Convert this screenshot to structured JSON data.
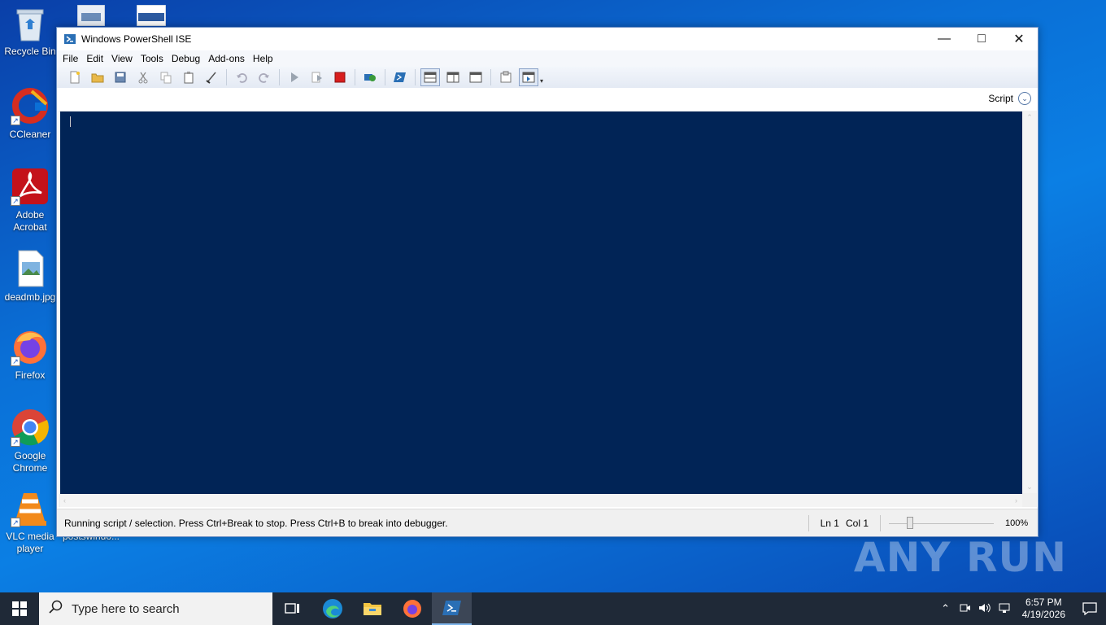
{
  "desktop": {
    "icons": [
      {
        "label": "Recycle Bin",
        "icon": "recycle-bin-icon"
      },
      {
        "label": "CCleaner",
        "icon": "ccleaner-icon"
      },
      {
        "label": "Adobe Acrobat",
        "icon": "acrobat-icon"
      },
      {
        "label": "deadmb.jpg",
        "icon": "image-file-icon"
      },
      {
        "label": "Firefox",
        "icon": "firefox-icon"
      },
      {
        "label": "Google Chrome",
        "icon": "chrome-icon"
      },
      {
        "label": "VLC media player",
        "icon": "vlc-icon"
      },
      {
        "label": "postswindo...",
        "icon": "file-icon"
      }
    ],
    "watermark": "ANY RUN"
  },
  "window": {
    "title": "Windows PowerShell ISE",
    "menu": [
      "File",
      "Edit",
      "View",
      "Tools",
      "Debug",
      "Add-ons",
      "Help"
    ],
    "toolbar_icons": [
      "new-icon",
      "open-icon",
      "save-icon",
      "cut-icon",
      "copy-icon",
      "paste-icon",
      "clear-icon",
      "undo-icon",
      "redo-icon",
      "run-icon",
      "run-selection-icon",
      "stop-icon",
      "remote-powershell-icon",
      "powershell-icon",
      "layout-top-icon",
      "layout-right-icon",
      "layout-max-icon",
      "commands-icon",
      "addon-pane-icon"
    ],
    "script_toggle_label": "Script",
    "status": {
      "message": "Running script / selection.  Press Ctrl+Break to stop.  Press Ctrl+B to break into debugger.",
      "line": "Ln 1",
      "col": "Col 1",
      "zoom": "100%",
      "zoom_level_fraction": 0.2
    }
  },
  "taskbar": {
    "search_placeholder": "Type here to search",
    "apps": [
      "task-view-icon",
      "edge-icon",
      "file-explorer-icon",
      "firefox-icon",
      "powershell-ise-icon"
    ],
    "clock_time": "6:57 PM",
    "clock_date": "4/19/2026"
  }
}
